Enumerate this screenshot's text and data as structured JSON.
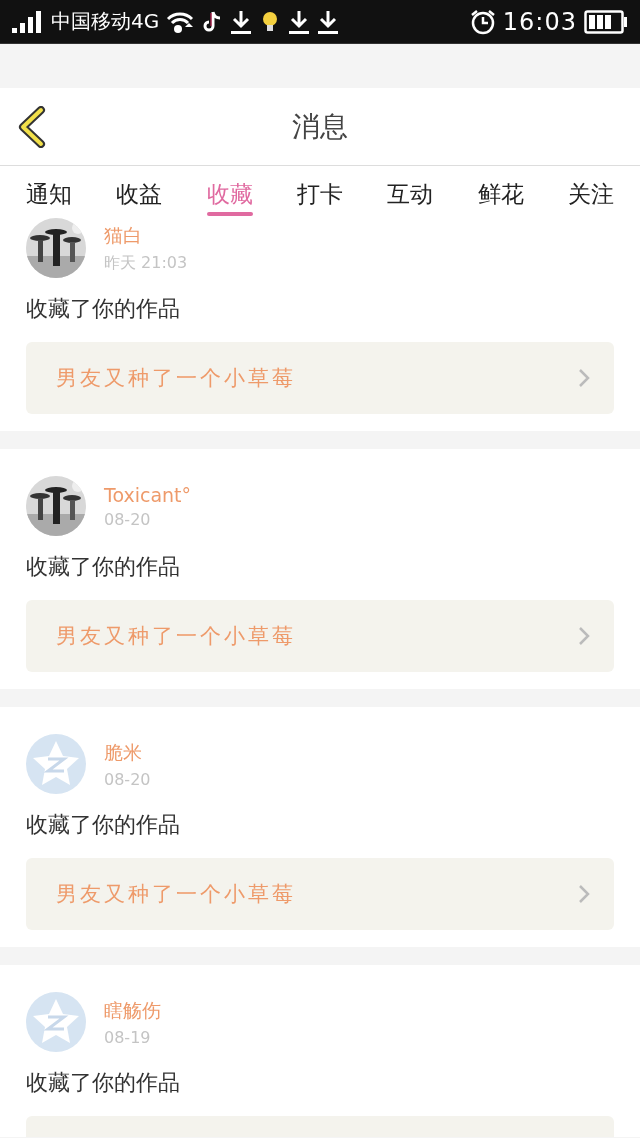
{
  "status_bar": {
    "carrier": "中国移动4G",
    "time": "16:03"
  },
  "header": {
    "title": "消息"
  },
  "tabs": [
    {
      "label": "通知",
      "selected": false
    },
    {
      "label": "收益",
      "selected": false
    },
    {
      "label": "收藏",
      "selected": true
    },
    {
      "label": "打卡",
      "selected": false
    },
    {
      "label": "互动",
      "selected": false
    },
    {
      "label": "鲜花",
      "selected": false
    },
    {
      "label": "关注",
      "selected": false
    }
  ],
  "messages": [
    {
      "kind": "picture",
      "name": "猫白",
      "time": "昨天 21:03",
      "action": "收藏了你的作品",
      "work": "男友又种了一个小草莓"
    },
    {
      "kind": "picture",
      "name": "Toxicant°",
      "time": "08-20",
      "action": "收藏了你的作品",
      "work": "男友又种了一个小草莓"
    },
    {
      "kind": "default",
      "name": "脆米",
      "time": "08-20",
      "action": "收藏了你的作品",
      "work": "男友又种了一个小草莓"
    },
    {
      "kind": "default",
      "name": "瞎觞伤",
      "time": "08-19",
      "action": "收藏了你的作品"
    }
  ]
}
